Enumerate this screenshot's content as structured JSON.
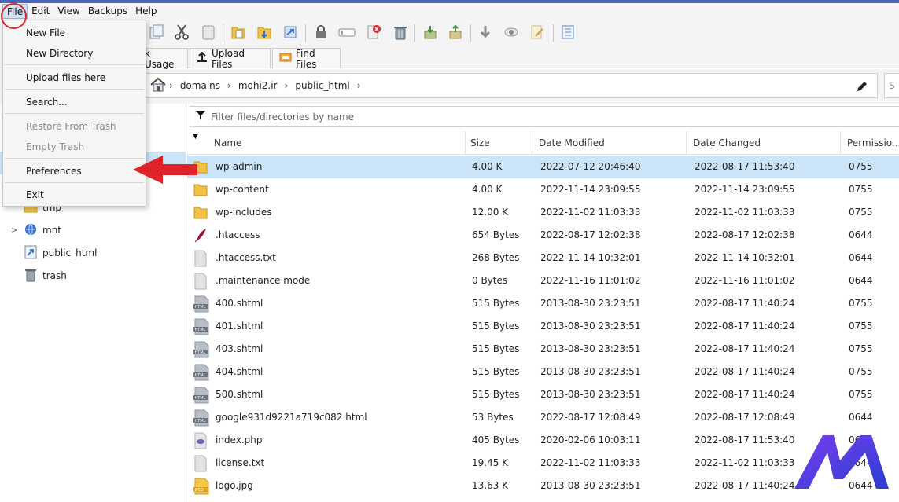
{
  "menubar": {
    "items": [
      "File",
      "Edit",
      "View",
      "Backups",
      "Help"
    ]
  },
  "file_menu": {
    "items": [
      {
        "label": "New File",
        "enabled": true
      },
      {
        "label": "New Directory",
        "enabled": true
      },
      {
        "label": "Upload files here",
        "enabled": true
      },
      {
        "label": "Search...",
        "enabled": true
      },
      {
        "label": "Restore From Trash",
        "enabled": false
      },
      {
        "label": "Empty Trash",
        "enabled": false
      },
      {
        "label": "Preferences",
        "enabled": true
      },
      {
        "label": "Exit",
        "enabled": true
      }
    ]
  },
  "toolbar": {
    "icons": [
      "copy-icon",
      "cut-icon",
      "paste-icon",
      "folder-copy-icon",
      "folder-move-icon",
      "folder-link-icon",
      "lock-icon",
      "rename-icon",
      "delete-file-icon",
      "trash-icon",
      "extract-icon",
      "compress-icon",
      "download-icon",
      "view-icon",
      "edit-icon",
      "checklist-icon"
    ]
  },
  "tabs": {
    "disk_usage": "k Usage",
    "upload_files": "Upload Files",
    "find_files": "Find Files"
  },
  "address": {
    "crumbs": [
      "domains",
      "mohi2.ir",
      "public_html"
    ],
    "search_placeholder": "S"
  },
  "tree": {
    "nodes": [
      {
        "label": "tmp",
        "icon": "folder-icon",
        "expandable": false
      },
      {
        "label": "mnt",
        "icon": "globe-folder-icon",
        "expandable": true
      },
      {
        "label": "public_html",
        "icon": "shortcut-icon",
        "expandable": false
      },
      {
        "label": "trash",
        "icon": "trash-icon",
        "expandable": false
      }
    ]
  },
  "filter": {
    "placeholder": "Filter files/directories by name"
  },
  "table": {
    "columns": [
      "Name",
      "Size",
      "Date Modified",
      "Date Changed",
      "Permissio..."
    ],
    "rows": [
      {
        "name": "wp-admin",
        "size": "4.00 K",
        "modified": "2022-07-12 20:46:40",
        "changed": "2022-08-17 11:53:40",
        "perm": "0755",
        "icon": "folder"
      },
      {
        "name": "wp-content",
        "size": "4.00 K",
        "modified": "2022-11-14 23:09:55",
        "changed": "2022-11-14 23:09:55",
        "perm": "0755",
        "icon": "folder"
      },
      {
        "name": "wp-includes",
        "size": "12.00 K",
        "modified": "2022-11-02 11:03:33",
        "changed": "2022-11-02 11:03:33",
        "perm": "0755",
        "icon": "folder"
      },
      {
        "name": ".htaccess",
        "size": "654 Bytes",
        "modified": "2022-08-17 12:02:38",
        "changed": "2022-08-17 12:02:38",
        "perm": "0644",
        "icon": "feather"
      },
      {
        "name": ".htaccess.txt",
        "size": "268 Bytes",
        "modified": "2022-11-14 10:32:01",
        "changed": "2022-11-14 10:32:01",
        "perm": "0644",
        "icon": "blank"
      },
      {
        "name": ".maintenance mode",
        "size": "0 Bytes",
        "modified": "2022-11-16 11:01:02",
        "changed": "2022-11-16 11:01:02",
        "perm": "0644",
        "icon": "blank"
      },
      {
        "name": "400.shtml",
        "size": "515 Bytes",
        "modified": "2013-08-30 23:23:51",
        "changed": "2022-08-17 11:40:24",
        "perm": "0755",
        "icon": "html"
      },
      {
        "name": "401.shtml",
        "size": "515 Bytes",
        "modified": "2013-08-30 23:23:51",
        "changed": "2022-08-17 11:40:24",
        "perm": "0755",
        "icon": "html"
      },
      {
        "name": "403.shtml",
        "size": "515 Bytes",
        "modified": "2013-08-30 23:23:51",
        "changed": "2022-08-17 11:40:24",
        "perm": "0755",
        "icon": "html"
      },
      {
        "name": "404.shtml",
        "size": "515 Bytes",
        "modified": "2013-08-30 23:23:51",
        "changed": "2022-08-17 11:40:24",
        "perm": "0755",
        "icon": "html"
      },
      {
        "name": "500.shtml",
        "size": "515 Bytes",
        "modified": "2013-08-30 23:23:51",
        "changed": "2022-08-17 11:40:24",
        "perm": "0755",
        "icon": "html"
      },
      {
        "name": "google931d9221a719c082.html",
        "size": "53 Bytes",
        "modified": "2022-08-17 12:08:49",
        "changed": "2022-08-17 12:08:49",
        "perm": "0644",
        "icon": "html"
      },
      {
        "name": "index.php",
        "size": "405 Bytes",
        "modified": "2020-02-06 10:03:11",
        "changed": "2022-08-17 11:53:40",
        "perm": "0644",
        "icon": "php"
      },
      {
        "name": "license.txt",
        "size": "19.45 K",
        "modified": "2022-11-02 11:03:33",
        "changed": "2022-11-02 11:03:33",
        "perm": "0644",
        "icon": "blank"
      },
      {
        "name": "logo.jpg",
        "size": "13.63 K",
        "modified": "2013-08-30 23:23:51",
        "changed": "2022-08-17 11:40:24",
        "perm": "0644",
        "icon": "jpeg"
      }
    ],
    "selected_row": 0
  },
  "colors": {
    "selection": "#cce4f7",
    "annotation_red": "#d8262b",
    "logo_purple": "#5b2bd6"
  }
}
